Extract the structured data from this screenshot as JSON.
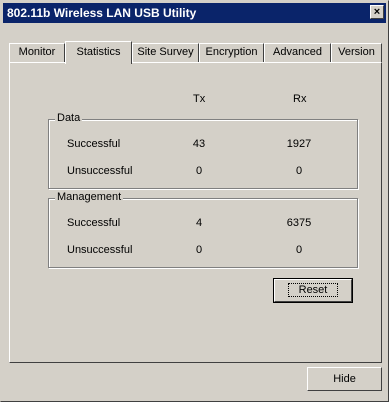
{
  "window": {
    "title": "802.11b Wireless LAN USB Utility",
    "close_glyph": "×"
  },
  "tabs": [
    {
      "label": "Monitor"
    },
    {
      "label": "Statistics"
    },
    {
      "label": "Site Survey"
    },
    {
      "label": "Encryption"
    },
    {
      "label": "Advanced"
    },
    {
      "label": "Version"
    }
  ],
  "active_tab": "Statistics",
  "columns": {
    "tx": "Tx",
    "rx": "Rx"
  },
  "data_group": {
    "label": "Data",
    "rows": [
      {
        "label": "Successful",
        "tx": "43",
        "rx": "1927"
      },
      {
        "label": "Unsuccessful",
        "tx": "0",
        "rx": "0"
      }
    ]
  },
  "management_group": {
    "label": "Management",
    "rows": [
      {
        "label": "Successful",
        "tx": "4",
        "rx": "6375"
      },
      {
        "label": "Unsuccessful",
        "tx": "0",
        "rx": "0"
      }
    ]
  },
  "buttons": {
    "reset": "Reset",
    "hide": "Hide"
  }
}
